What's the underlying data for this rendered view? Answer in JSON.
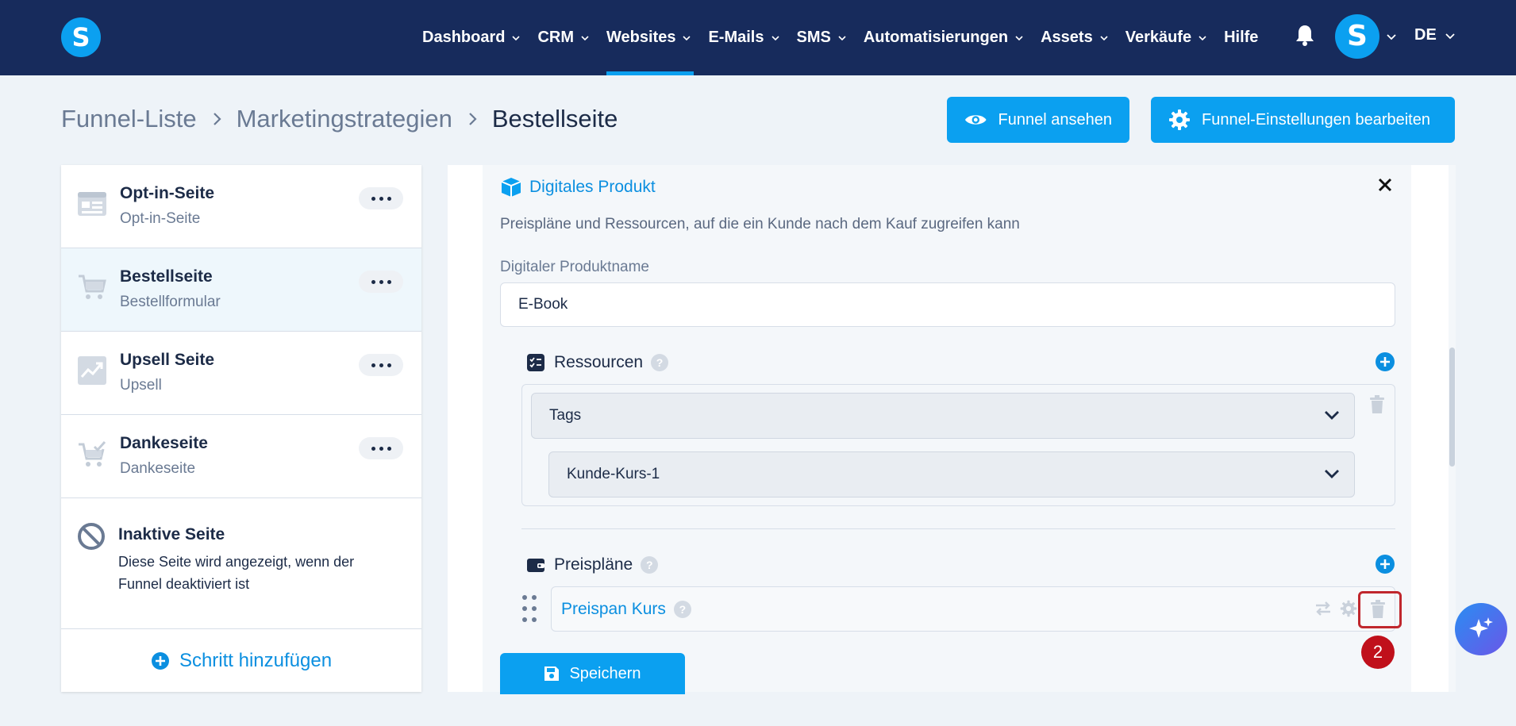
{
  "brand": {
    "logo_letter": "S",
    "accent": "#0ba0f0",
    "nav_bg": "#172b5c"
  },
  "nav": {
    "items": [
      {
        "label": "Dashboard",
        "has_dropdown": true,
        "active": false
      },
      {
        "label": "CRM",
        "has_dropdown": true,
        "active": false
      },
      {
        "label": "Websites",
        "has_dropdown": true,
        "active": true
      },
      {
        "label": "E-Mails",
        "has_dropdown": true,
        "active": false
      },
      {
        "label": "SMS",
        "has_dropdown": true,
        "active": false
      },
      {
        "label": "Automatisierungen",
        "has_dropdown": true,
        "active": false
      },
      {
        "label": "Assets",
        "has_dropdown": true,
        "active": false
      },
      {
        "label": "Verkäufe",
        "has_dropdown": true,
        "active": false
      },
      {
        "label": "Hilfe",
        "has_dropdown": false,
        "active": false
      }
    ],
    "notification_icon": "bell-icon",
    "avatar_letter": "S",
    "language": "DE"
  },
  "breadcrumb": {
    "items": [
      "Funnel-Liste",
      "Marketingstrategien",
      "Bestellseite"
    ]
  },
  "actions": {
    "view_funnel": "Funnel ansehen",
    "edit_settings": "Funnel-Einstellungen bearbeiten"
  },
  "steps": [
    {
      "title": "Opt-in-Seite",
      "subtitle": "Opt-in-Seite",
      "icon": "form-page-icon",
      "active": false
    },
    {
      "title": "Bestellseite",
      "subtitle": "Bestellformular",
      "icon": "cart-icon",
      "active": true
    },
    {
      "title": "Upsell Seite",
      "subtitle": "Upsell",
      "icon": "chart-up-icon",
      "active": false
    },
    {
      "title": "Dankeseite",
      "subtitle": "Dankeseite",
      "icon": "cart-check-icon",
      "active": false
    }
  ],
  "inactive_page": {
    "title": "Inaktive Seite",
    "description": "Diese Seite wird angezeigt, wenn der Funnel deaktiviert ist"
  },
  "add_step_label": "Schritt hinzufügen",
  "digital_product": {
    "title": "Digitales Produkt",
    "description": "Preispläne und Ressourcen, auf die ein Kunde nach dem Kauf zugreifen kann",
    "name_label": "Digitaler Produktname",
    "name_value": "E-Book",
    "resources": {
      "label": "Ressourcen",
      "type_value": "Tags",
      "tag_value": "Kunde-Kurs-1"
    },
    "price_plans": {
      "label": "Preispläne",
      "items": [
        {
          "name": "Preispan Kurs"
        }
      ]
    },
    "save_label": "Speichern"
  },
  "annotation": {
    "step_number": "2"
  }
}
